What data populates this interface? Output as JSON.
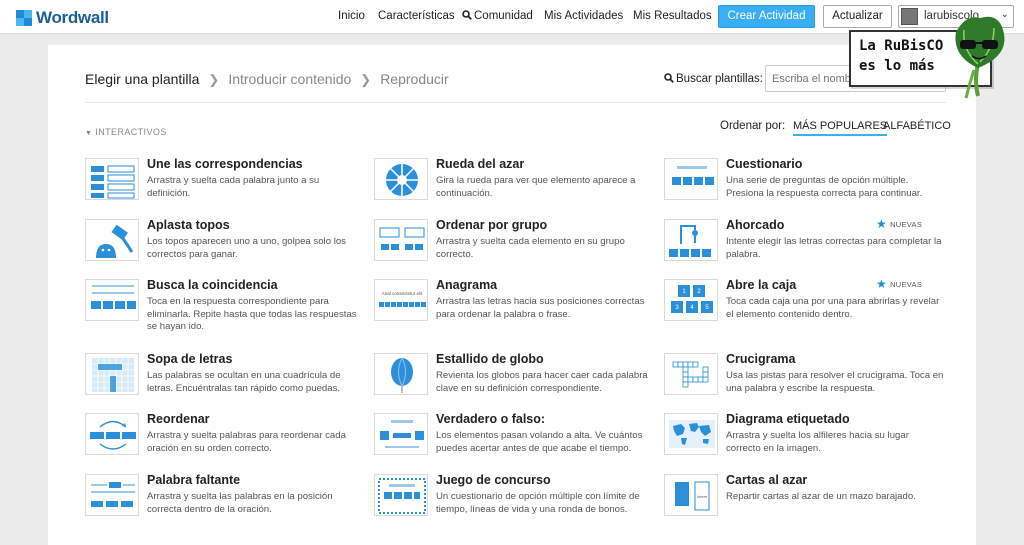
{
  "app": {
    "logo_text": "Wordwall"
  },
  "nav": {
    "home": "Inicio",
    "features": "Características",
    "community": "Comunidad",
    "my_activities": "Mis Actividades",
    "my_results": "Mis Resultados",
    "create_button": "Crear Actividad",
    "update_button": "Actualizar",
    "user_name": "larubiscolo"
  },
  "steps": {
    "step1": "Elegir una plantilla",
    "step2": "Introducir contenido",
    "step3": "Reproducir"
  },
  "search": {
    "label": "Buscar plantillas:",
    "placeholder": "Escriba el nombre"
  },
  "section": {
    "label": "INTERACTIVOS"
  },
  "sort": {
    "label": "Ordenar por:",
    "popular": "MÁS POPULARES",
    "alphabetic": "ALFABÉTICO"
  },
  "templates": {
    "t1": {
      "title": "Une las correspondencias",
      "desc": "Arrastra y suelta cada palabra junto a su definición."
    },
    "t2": {
      "title": "Rueda del azar",
      "desc": "Gira la rueda para ver que elemento aparece a continuación."
    },
    "t3": {
      "title": "Cuestionario",
      "desc": "Una serie de preguntas de opción múltiple. Presiona la respuesta correcta para continuar."
    },
    "t4": {
      "title": "Aplasta topos",
      "desc": "Los topos aparecen uno a uno, golpea solo los correctos para ganar."
    },
    "t5": {
      "title": "Ordenar por grupo",
      "desc": "Arrastra y suelta cada elemento en su grupo correcto."
    },
    "t6": {
      "title": "Ahorcado",
      "desc": "Intente elegir las letras correctas para completar la palabra.",
      "badge": "NUEVAS"
    },
    "t7": {
      "title": "Busca la coincidencia",
      "desc": "Toca en la respuesta correspondiente para eliminarla. Repite hasta que todas las respuestas se hayan ido."
    },
    "t8": {
      "title": "Anagrama",
      "desc": "Arrastra las letras hacia sus posiciones correctas para ordenar la palabra o frase."
    },
    "t9": {
      "title": "Abre la caja",
      "desc": "Toca cada caja una por una para abrirlas y revelar el elemento contenido dentro.",
      "badge": "NUEVAS"
    },
    "t10": {
      "title": "Sopa de letras",
      "desc": "Las palabras se ocultan en una cuadrícula de letras. Encuéntralas tan rápido como puedas."
    },
    "t11": {
      "title": "Estallido de globo",
      "desc": "Revienta los globos para hacer caer cada palabra clave en su definición correspondiente."
    },
    "t12": {
      "title": "Crucigrama",
      "desc": "Usa las pistas para resolver el crucigrama. Toca en una palabra y escribe la respuesta."
    },
    "t13": {
      "title": "Reordenar",
      "desc": "Arrastra y suelta palabras para reordenar cada oración en su orden correcto."
    },
    "t14": {
      "title": "Verdadero o falso:",
      "desc": "Los elementos pasan volando a alta. Ve cuántos puedes acertar antes de que acabe el tiempo."
    },
    "t15": {
      "title": "Diagrama etiquetado",
      "desc": "Arrastra y suelta los alfileres hacia su lugar correcto en la imagen."
    },
    "t16": {
      "title": "Palabra faltante",
      "desc": "Arrastra y suelta las palabras en la posición correcta dentro de la oración."
    },
    "t17": {
      "title": "Juego de concurso",
      "desc": "Un cuestionario de opción múltiple con límite de tiempo, líneas de vida y una ronda de bonos."
    },
    "t18": {
      "title": "Cartas al azar",
      "desc": "Repartir cartas al azar de un mazo barajado."
    }
  },
  "thumb_text": {
    "whack": "",
    "anagram": "Anal consectetur elit",
    "random_cards": "lorem"
  },
  "sticker": {
    "line1": "La RuBisCO",
    "line2": "es lo más"
  },
  "colors": {
    "accent": "#3aaef2",
    "thumb_blue": "#2b8fd9",
    "logo": "#1c5e96"
  }
}
